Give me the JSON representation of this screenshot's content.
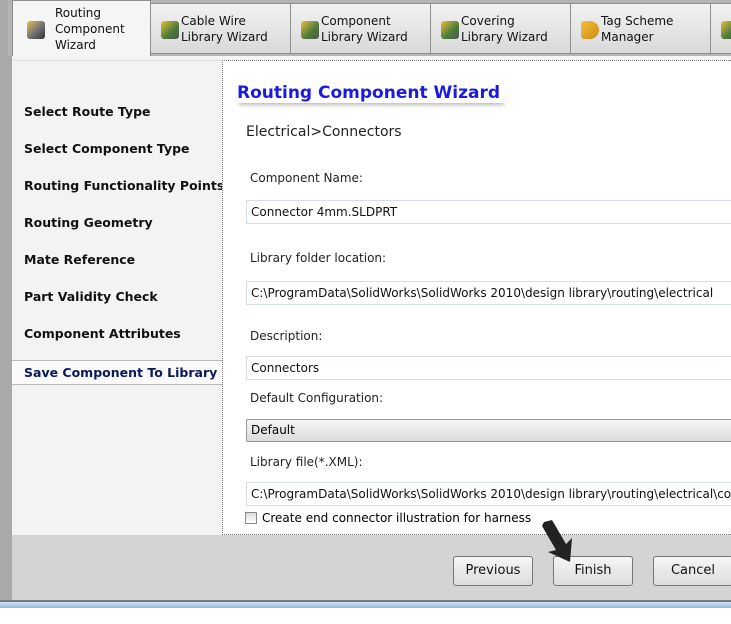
{
  "tabs": [
    {
      "label": "Routing Component Wizard",
      "icon": "routing-component-icon",
      "active": true
    },
    {
      "label": "Cable Wire Library Wizard",
      "icon": "cable-wire-icon"
    },
    {
      "label": "Component Library Wizard",
      "icon": "component-library-icon"
    },
    {
      "label": "Covering Library Wizard",
      "icon": "covering-library-icon"
    },
    {
      "label": "Tag Scheme Manager",
      "icon": "tag-icon"
    }
  ],
  "sidebar": {
    "items": [
      {
        "label": "Select Route Type"
      },
      {
        "label": "Select Component Type"
      },
      {
        "label": "Routing Functionality Points"
      },
      {
        "label": "Routing Geometry"
      },
      {
        "label": "Mate Reference"
      },
      {
        "label": "Part Validity Check"
      },
      {
        "label": "Component Attributes"
      },
      {
        "label": "Save Component To Library",
        "selected": true
      }
    ]
  },
  "main": {
    "title": "Routing Component Wizard",
    "breadcrumb": "Electrical>Connectors",
    "component_name_label": "Component Name:",
    "component_name": "Connector 4mm.SLDPRT",
    "library_folder_label": "Library folder location:",
    "library_folder": "C:\\ProgramData\\SolidWorks\\SolidWorks 2010\\design library\\routing\\electrical",
    "description_label": "Description:",
    "description": "Connectors",
    "default_config_label": "Default Configuration:",
    "default_config": "Default",
    "library_file_label": "Library file(*.XML):",
    "library_file": "C:\\ProgramData\\SolidWorks\\SolidWorks 2010\\design library\\routing\\electrical\\components.xml",
    "checkbox_label": "Create end connector illustration for harness",
    "checkbox_checked": false
  },
  "buttons": {
    "previous": "Previous",
    "finish": "Finish",
    "cancel": "Cancel"
  },
  "colors": {
    "title": "#1a1ae0",
    "selected_item": "#0a1a5a"
  }
}
